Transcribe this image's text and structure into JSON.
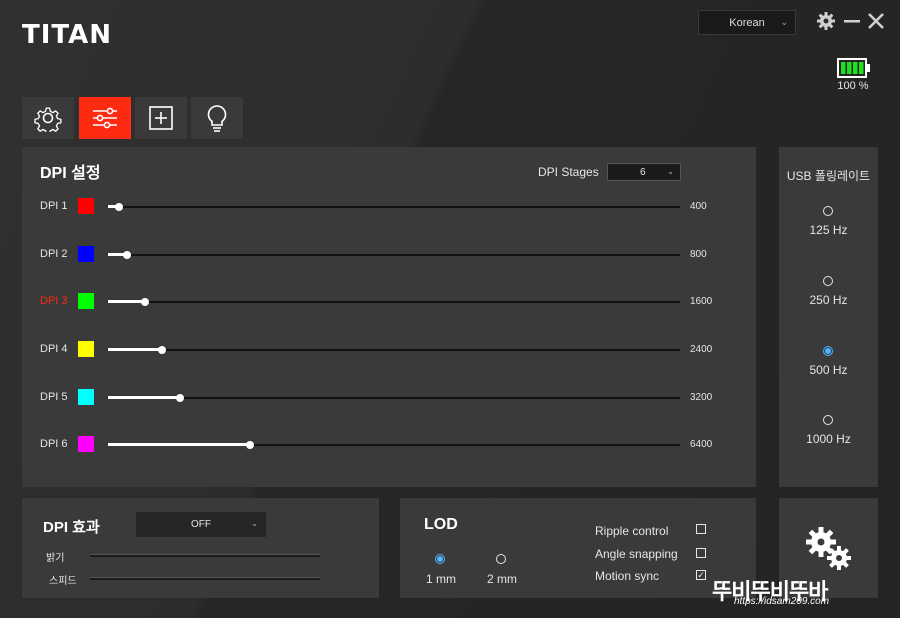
{
  "app": {
    "logo": "TITAN"
  },
  "header": {
    "language": "Korean",
    "battery_text": "100 %",
    "battery_level": 1.0
  },
  "tabs": [
    {
      "icon": "gear-icon",
      "active": false
    },
    {
      "icon": "sliders-icon",
      "active": true
    },
    {
      "icon": "macro-plus-icon",
      "active": false
    },
    {
      "icon": "lightbulb-icon",
      "active": false
    }
  ],
  "dpi": {
    "title": "DPI 설정",
    "stages_label": "DPI Stages",
    "stages_value": "6",
    "rows": [
      {
        "label": "DPI 1",
        "color": "#ff0000",
        "value": "400",
        "fraction": 0.02,
        "active": false
      },
      {
        "label": "DPI 2",
        "color": "#0000ff",
        "value": "800",
        "fraction": 0.033,
        "active": false
      },
      {
        "label": "DPI 3",
        "color": "#00ff00",
        "value": "1600",
        "fraction": 0.065,
        "active": true
      },
      {
        "label": "DPI 4",
        "color": "#ffff00",
        "value": "2400",
        "fraction": 0.095,
        "active": false
      },
      {
        "label": "DPI 5",
        "color": "#00ffff",
        "value": "3200",
        "fraction": 0.125,
        "active": false
      },
      {
        "label": "DPI 6",
        "color": "#ff00ff",
        "value": "6400",
        "fraction": 0.248,
        "active": false
      }
    ]
  },
  "usb": {
    "title": "USB 폴링레이트",
    "options": [
      {
        "label": "125 Hz",
        "checked": false
      },
      {
        "label": "250 Hz",
        "checked": false
      },
      {
        "label": "500 Hz",
        "checked": true
      },
      {
        "label": "1000 Hz",
        "checked": false
      }
    ]
  },
  "effect": {
    "title": "DPI 효과",
    "mode": "OFF",
    "brightness_label": "밝기",
    "speed_label": "스피드"
  },
  "lod": {
    "title": "LOD",
    "options": [
      {
        "label": "1 mm",
        "checked": true
      },
      {
        "label": "2 mm",
        "checked": false
      }
    ],
    "checks": [
      {
        "label": "Ripple control",
        "checked": false
      },
      {
        "label": "Angle snapping",
        "checked": false
      },
      {
        "label": "Motion sync",
        "checked": true
      }
    ]
  },
  "watermark": {
    "big": "뚜비뚜비뚜바",
    "small": "https://idsam209.com"
  },
  "colors": {
    "accent": "#ff2a12",
    "radio_accent": "#4fb4ff",
    "battery": "#22dd22"
  }
}
